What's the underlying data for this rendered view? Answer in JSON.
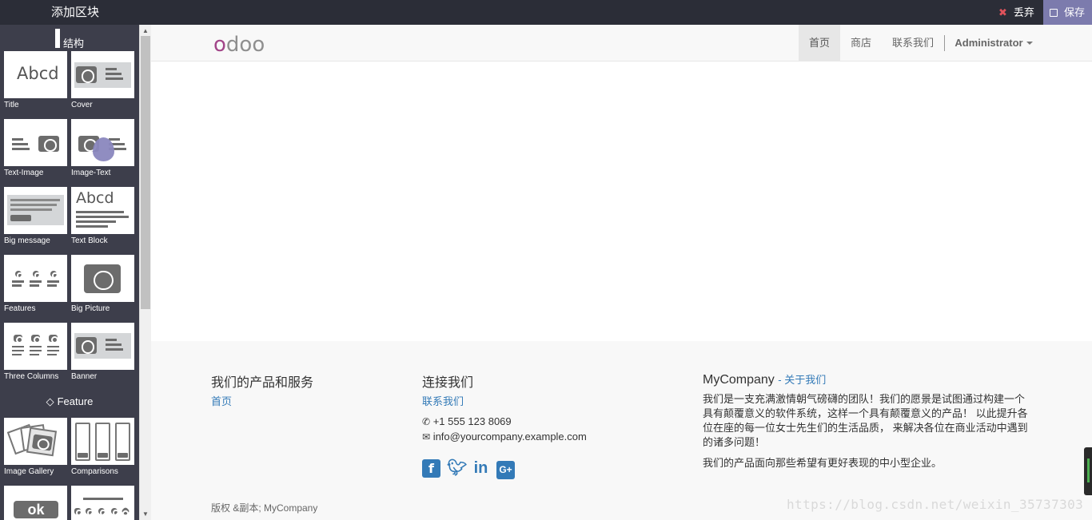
{
  "editor": {
    "panel_title": "添加区块",
    "discard_label": "丢弃",
    "save_label": "保存",
    "accent": "#7c7bad"
  },
  "sidebar": {
    "structure_title": "结构",
    "feature_title": "Feature",
    "structure_tiles": [
      {
        "label": "Title",
        "icon": "abcd-icon"
      },
      {
        "label": "Cover",
        "icon": "camera-text-icon"
      },
      {
        "label": "Text-Image",
        "icon": "text-camera-icon"
      },
      {
        "label": "Image-Text",
        "icon": "camera-text-icon"
      },
      {
        "label": "Big message",
        "icon": "big-message-icon"
      },
      {
        "label": "Text Block",
        "icon": "abcd-text-icon"
      },
      {
        "label": "Features",
        "icon": "features-icon"
      },
      {
        "label": "Big Picture",
        "icon": "camera-icon"
      },
      {
        "label": "Three Columns",
        "icon": "three-columns-icon"
      },
      {
        "label": "Banner",
        "icon": "banner-icon"
      }
    ],
    "feature_tiles": [
      {
        "label": "Image Gallery",
        "icon": "gallery-icon"
      },
      {
        "label": "Comparisons",
        "icon": "comparisons-icon"
      },
      {
        "label": "",
        "icon": "ok-button-icon",
        "text": "ok"
      },
      {
        "label": "",
        "icon": "share-icon"
      }
    ]
  },
  "site": {
    "logo": "odoo",
    "nav": {
      "home": "首页",
      "shop": "商店",
      "contact": "联系我们",
      "user": "Administrator"
    }
  },
  "footer": {
    "col1_title": "我们的产品和服务",
    "col1_link": "首页",
    "col2_title": "连接我们",
    "col2_link": "联系我们",
    "phone": "+1 555 123 8069",
    "email": "info@yourcompany.example.com",
    "social": [
      "facebook-icon",
      "twitter-icon",
      "linkedin-icon",
      "google-plus-icon"
    ],
    "company_name": "MyCompany",
    "about_link": "- 关于我们",
    "about_p1": "我们是一支充满激情朝气磅礴的团队！我们的愿景是试图通过构建一个具有颠覆意义的软件系统，这样一个具有颠覆意义的产品！ 以此提升各位在座的每一位女士先生们的生活品质， 来解决各位在商业活动中遇到的诸多问题！",
    "about_p2": "我们的产品面向那些希望有更好表现的中小型企业。",
    "copyright": "版权 &副本; MyCompany"
  },
  "watermark": "https://blog.csdn.net/weixin_35737303"
}
